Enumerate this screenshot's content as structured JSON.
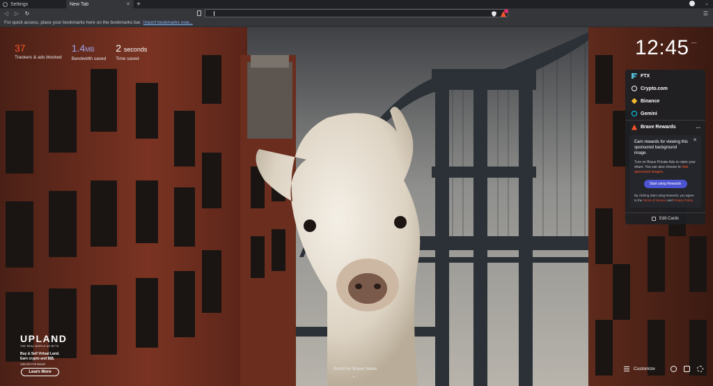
{
  "tabs": [
    {
      "label": "Settings",
      "active": false
    },
    {
      "label": "New Tab",
      "active": true
    }
  ],
  "toolbar": {
    "url_value": "",
    "url_placeholder": ""
  },
  "bookmarks_bar": {
    "message": "For quick access, place your bookmarks here on the bookmarks bar.",
    "import_link": "Import bookmarks now..."
  },
  "stats": [
    {
      "value": "37",
      "unit": "",
      "label": "Trackers & ads blocked",
      "color": "#fb542b"
    },
    {
      "value": "1.4",
      "unit": "MB",
      "label": "Bandwidth saved",
      "color": "#a0a5eb"
    },
    {
      "value": "2",
      "unit": "seconds",
      "label": "Time saved",
      "color": "#ffffff"
    }
  ],
  "clock": {
    "time": "12:45",
    "menu": "..."
  },
  "cards": {
    "crypto": [
      {
        "label": "FTX",
        "icon": "ftx-icon"
      },
      {
        "label": "Crypto.com",
        "icon": "crypto-com-icon"
      },
      {
        "label": "Binance",
        "icon": "binance-icon"
      },
      {
        "label": "Gemini",
        "icon": "gemini-icon"
      }
    ],
    "rewards": {
      "title": "Brave Rewards",
      "more": "...",
      "close": "✕",
      "heading": "Earn rewards for viewing this sponsored background image.",
      "body_prefix": "Turn on Brave Private Ads to claim your share. You can also choose to",
      "body_link": "hide sponsored images.",
      "button": "Start using Rewards",
      "legal_prefix": "By clicking Start using Rewards, you agree to the",
      "legal_terms": "Terms of Service",
      "legal_and": "and",
      "legal_privacy": "Privacy Policy."
    },
    "edit_label": "Edit Cards"
  },
  "sponsor": {
    "logo": "UPLAND",
    "tagline": "THE REAL WORLD AS NFTS",
    "line1": "Buy & Sell Virtual Land.",
    "line2": "Earn crypto and $$$.",
    "small": "3,000 UPX FOR SIGNUP",
    "learn_more": "Learn More"
  },
  "bottom": {
    "scroll_hint": "Scroll for Brave News",
    "customize": "Customize"
  },
  "colors": {
    "brave_orange": "#fb542b",
    "rewards_button": "#4c54d2",
    "chrome_bg": "#35363a"
  }
}
